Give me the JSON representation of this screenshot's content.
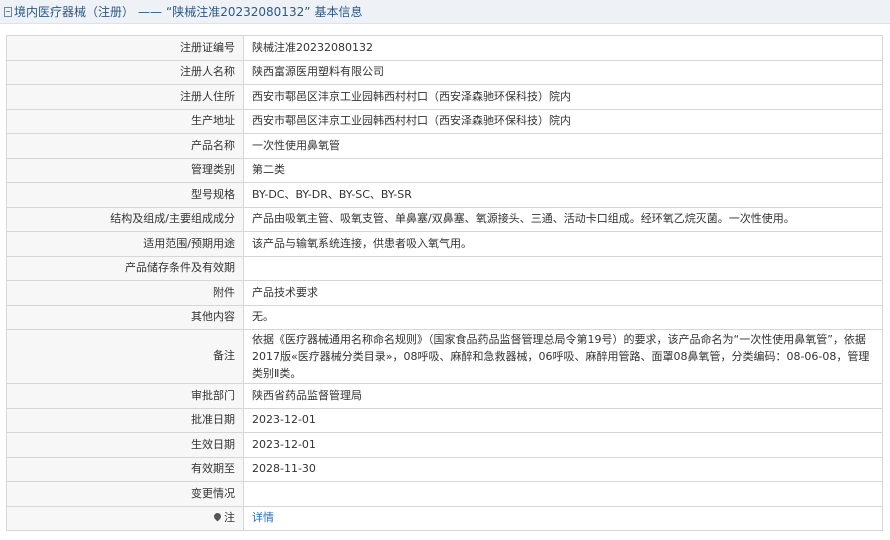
{
  "header": {
    "section": "境内医疗器械（注册）",
    "separator": "——",
    "reg_quoted": "“陕械注准20232080132”",
    "suffix": "基本信息"
  },
  "rows": [
    {
      "label": "注册证编号",
      "value": "陕械注准20232080132"
    },
    {
      "label": "注册人名称",
      "value": "陕西富源医用塑料有限公司"
    },
    {
      "label": "注册人住所",
      "value": "西安市鄠邑区沣京工业园韩西村村口（西安泽森驰环保科技）院内"
    },
    {
      "label": "生产地址",
      "value": "西安市鄠邑区沣京工业园韩西村村口（西安泽森驰环保科技）院内"
    },
    {
      "label": "产品名称",
      "value": "一次性使用鼻氧管"
    },
    {
      "label": "管理类别",
      "value": "第二类"
    },
    {
      "label": "型号规格",
      "value": "BY-DC、BY-DR、BY-SC、BY-SR"
    },
    {
      "label": "结构及组成/主要组成成分",
      "value": "产品由吸氧主管、吸氧支管、单鼻塞/双鼻塞、氧源接头、三通、活动卡口组成。经环氧乙烷灭菌。一次性使用。"
    },
    {
      "label": "适用范围/预期用途",
      "value": "该产品与输氧系统连接，供患者吸入氧气用。"
    },
    {
      "label": "产品储存条件及有效期",
      "value": ""
    },
    {
      "label": "附件",
      "value": "产品技术要求"
    },
    {
      "label": "其他内容",
      "value": "无。"
    },
    {
      "label": "备注",
      "value": "依据《医疗器械通用名称命名规则》（国家食品药品监督管理总局令第19号）的要求，该产品命名为“一次性使用鼻氧管”，依据2017版«医疗器械分类目录»，08呼吸、麻醉和急救器械，06呼吸、麻醉用管路、面罩08鼻氧管，分类编码：08-06-08，管理类别Ⅱ类。"
    },
    {
      "label": "审批部门",
      "value": "陕西省药品监督管理局"
    },
    {
      "label": "批准日期",
      "value": "2023-12-01"
    },
    {
      "label": "生效日期",
      "value": "2023-12-01"
    },
    {
      "label": "有效期至",
      "value": "2028-11-30"
    },
    {
      "label": "变更情况",
      "value": ""
    }
  ],
  "note_row": {
    "label": "注",
    "link": "详情"
  }
}
